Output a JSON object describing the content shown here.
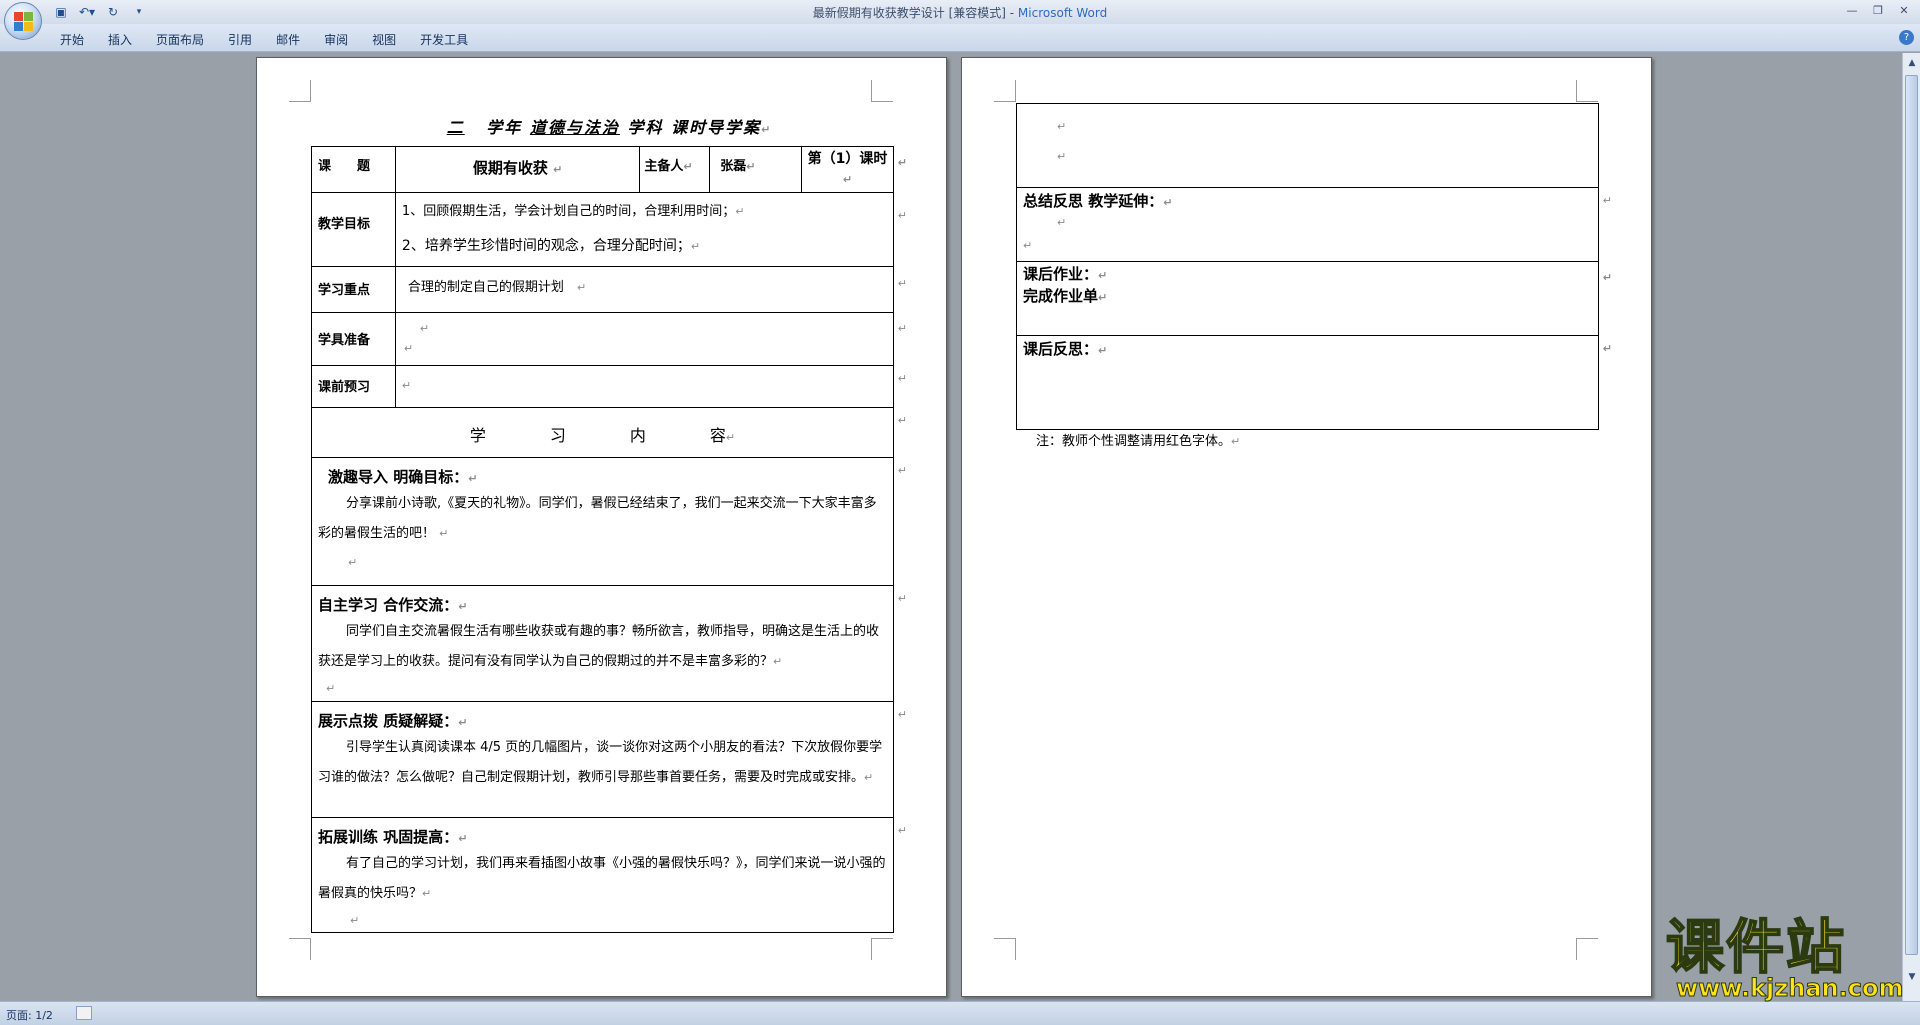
{
  "window": {
    "title": "最新假期有收获教学设计 [兼容模式] - ",
    "app_name": "Microsoft Word"
  },
  "ribbon": {
    "tabs": [
      "开始",
      "插入",
      "页面布局",
      "引用",
      "邮件",
      "审阅",
      "视图",
      "开发工具"
    ]
  },
  "document": {
    "header": {
      "blank": "二",
      "year_label": "学年",
      "subject": "道德与法治",
      "subject_label": "学科",
      "plan_label": "课时导学案"
    },
    "row_title": {
      "label": "课　　题",
      "value": "假期有收获",
      "prep_label": "主备人",
      "prep_value": "张磊",
      "period": "第（1）课时"
    },
    "goals": {
      "label": "教学目标",
      "items": [
        "1、回顾假期生活，学会计划自己的时间，合理利用时间；",
        "2、培养学生珍惜时间的观念，合理分配时间；"
      ]
    },
    "focus": {
      "label": "学习重点",
      "value": "合理的制定自己的假期计划"
    },
    "tools": {
      "label": "学具准备"
    },
    "preview": {
      "label": "课前预习"
    },
    "content_header": "学　　　　习　　　　内　　　　容",
    "sections": [
      {
        "title": "激趣导入 明确目标：",
        "text": "分享课前小诗歌,《夏天的礼物》。同学们，暑假已经结束了，我们一起来交流一下大家丰富多彩的暑假生活的吧！"
      },
      {
        "title": "自主学习 合作交流：",
        "text": "同学们自主交流暑假生活有哪些收获或有趣的事？畅所欲言，教师指导，明确这是生活上的收获还是学习上的收获。提问有没有同学认为自己的假期过的并不是丰富多彩的？"
      },
      {
        "title": "展示点拨 质疑解疑：",
        "text": "引导学生认真阅读课本 4/5 页的几幅图片，谈一谈你对这两个小朋友的看法？下次放假你要学习谁的做法？怎么做呢？自己制定假期计划，教师引导那些事首要任务，需要及时完成或安排。"
      },
      {
        "title": "拓展训练 巩固提高：",
        "text": "有了自己的学习计划，我们再来看插图小故事《小强的暑假快乐吗？》，同学们来说一说小强的暑假真的快乐吗？"
      }
    ],
    "page2": {
      "reflect_label": "总结反思 教学延伸：",
      "homework_label": "课后作业：",
      "homework_value": "完成作业单",
      "after_label": "课后反思：",
      "note": "注：教师个性调整请用红色字体。"
    },
    "paragraph_mark": "↵"
  },
  "status": {
    "page": "页面: 1/2"
  },
  "watermark": {
    "name": "课件站",
    "url": "www.kjzhan.com"
  }
}
